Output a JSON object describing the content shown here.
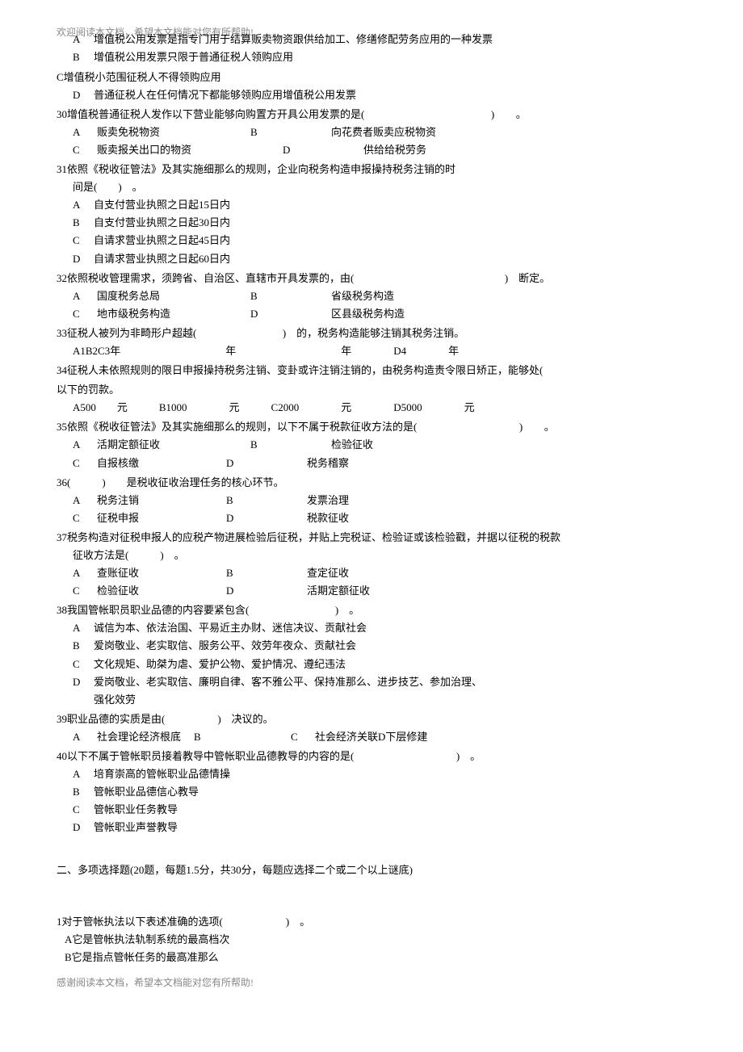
{
  "header": "欢迎阅读本文档，希望本文档能对您有所帮助!",
  "footer": "感谢阅读本文档，希望本文档能对您有所帮助!",
  "q29": {
    "a": "增值税公用发票是指专门用于结算贩卖物资跟供给加工、修缮修配劳务应用的一种发票",
    "b": "增值税公用发票只限于普通征税人领购应用",
    "c": "C增值税小范围征税人不得领购应用",
    "d": "普通征税人在任何情况下都能够领购应用增值税公用发票"
  },
  "q30": {
    "stem": "30增值税普通征税人发作以下营业能够向购置方开具公用发票的是(",
    "stem2": ")",
    "dot": "。",
    "a": "贩卖免税物资",
    "b": "向花费者贩卖应税物资",
    "c": "贩卖报关出口的物资",
    "d": "供给给税劳务"
  },
  "q31": {
    "l1": "31依照《税收征管法》及其实施细那么的规则，企业向税务构造申报操持税务注销的时",
    "l2": "间是(  ) 。",
    "a": "自支付营业执照之日起15日内",
    "b": "自支付营业执照之日起30日内",
    "c": "自请求营业执照之日起45日内",
    "d": "自请求营业执照之日起60日内"
  },
  "q32": {
    "stem": "32依照税收管理需求，须跨省、自治区、直辖市开具发票的，由(",
    "stem2": ") 断定。",
    "a": "国度税务总局",
    "b": "省级税务构造",
    "c": "地市级税务构造",
    "d": "区县级税务构造"
  },
  "q33": {
    "stem": "33征税人被列为非畸形户超越(",
    "mid": ") 的，税务构造能够注销其税务注销。",
    "row": "A1B2C3年          年          年    D4    年"
  },
  "q34": {
    "l1": "34征税人未依照规则的限日申报操持税务注销、变卦或许注销注销的，由税务构造责令限日矫正，能够处(",
    "l1b": ")",
    "l2": "以下的罚款。",
    "row": "A500  元   B1000    元   C2000    元    D5000    元"
  },
  "q35": {
    "stem": "35依照《税收征管法》及其实施细那么的规则，以下不属于税款征收方法的是(",
    "stem2": ")",
    "dot": "。",
    "a": "活期定额征收",
    "b": "检验征收",
    "c": "自报核缴",
    "d": "税务稽察"
  },
  "q36": {
    "stem": "36(   )  是税收征收治理任务的核心环节。",
    "a": "税务注销",
    "b": "发票治理",
    "c": "征税申报",
    "d": "税款征收"
  },
  "q37": {
    "l1": "37税务构造对征税申报人的应税产物进展检验后征税，并贴上完税证、检验证或该检验戳，并据以征税的税款",
    "l2": "征收方法是(   ) 。",
    "a": "查账征收",
    "b": "查定征收",
    "c": "检验征收",
    "d": "活期定额征收"
  },
  "q38": {
    "stem": "38我国管帐职员职业品德的内容要紧包含(",
    "stem2": ") 。",
    "a": "诚信为本、依法治国、平易近主办财、迷信决议、贡献社会",
    "b": "爱岗敬业、老实取信、服务公平、效劳年夜众、贡献社会",
    "c": "文化规矩、助桀为虐、爱护公物、爱护情况、遵纪违法",
    "d1": "爱岗敬业、老实取信、廉明自律、客不雅公平、保持准那么、进步技艺、参加治理、",
    "d2": "强化效劳"
  },
  "q39": {
    "stem": "39职业品德的实质是由(     ) 决议的。",
    "a": "社会理论经济根底",
    "b": "B",
    "c": "社会经济关联D下层修建"
  },
  "q40": {
    "stem": "40以下不属于管帐职员接着教导中管帐职业品德教导的内容的是(",
    "stem2": ") 。",
    "a": "培育崇高的管帐职业品德情操",
    "b": "管帐职业品德信心教导",
    "c": "管帐职业任务教导",
    "d": "管帐职业声誉教导"
  },
  "section2": "二、多项选择题(20题，每题1.5分，共30分，每题应选择二个或二个以上谜底)",
  "m1": {
    "stem": "1对于管帐执法以下表述准确的选项(      ) 。",
    "a": "A它是管帐执法轨制系统的最高档次",
    "b": "B它是指点管帐任务的最高准那么"
  }
}
